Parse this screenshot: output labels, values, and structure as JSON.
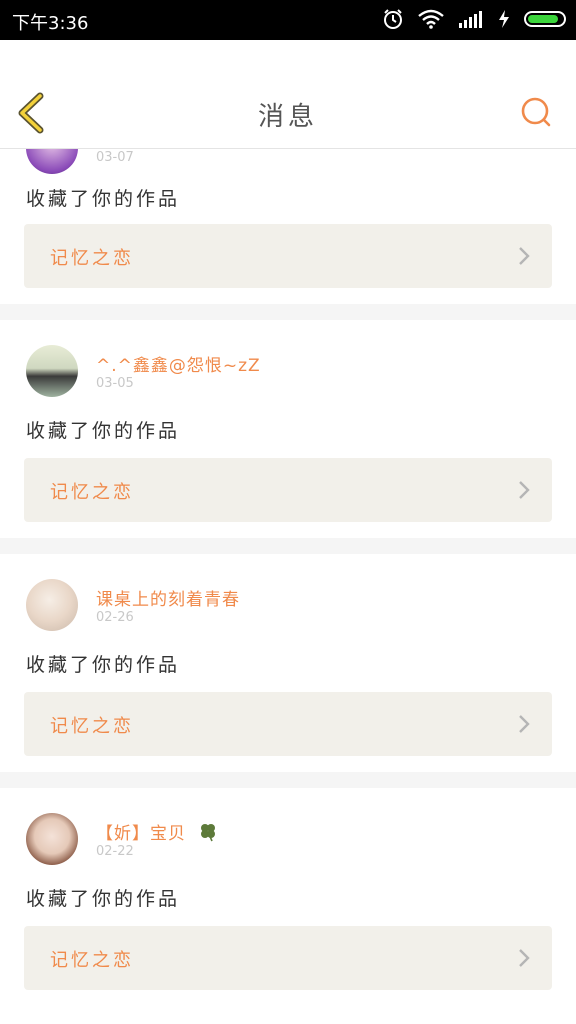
{
  "status_bar": {
    "time": "下午3:36",
    "icons": [
      "alarm-icon",
      "wifi-icon",
      "signal-icon",
      "charging-icon",
      "battery-icon"
    ]
  },
  "header": {
    "title": "消息",
    "back_icon": "chevron-left-icon",
    "search_icon": "search-icon",
    "accent_color": "#f08a4b"
  },
  "messages": [
    {
      "user": "",
      "date": "03-07",
      "action": "收藏了你的作品",
      "work": "记忆之恋"
    },
    {
      "user": "^.^鑫鑫@怨恨~zZ",
      "date": "03-05",
      "action": "收藏了你的作品",
      "work": "记忆之恋"
    },
    {
      "user": "课桌上的刻着青春",
      "date": "02-26",
      "action": "收藏了你的作品",
      "work": "记忆之恋"
    },
    {
      "user": "【妡】宝贝",
      "date": "02-22",
      "action": "收藏了你的作品",
      "work": "记忆之恋"
    }
  ]
}
